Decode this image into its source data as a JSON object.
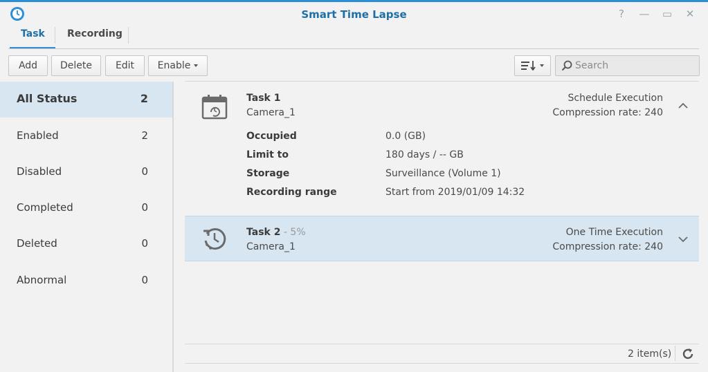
{
  "app": {
    "title": "Smart Time Lapse"
  },
  "window_controls": {
    "help": "?",
    "minimize": "—",
    "maximize": "▭",
    "close": "✕"
  },
  "tabs": [
    {
      "label": "Task"
    },
    {
      "label": "Recording"
    }
  ],
  "toolbar": {
    "add": "Add",
    "delete": "Delete",
    "edit": "Edit",
    "enable": "Enable",
    "search_placeholder": "Search"
  },
  "sidebar": {
    "items": [
      {
        "label": "All Status",
        "count": "2"
      },
      {
        "label": "Enabled",
        "count": "2"
      },
      {
        "label": "Disabled",
        "count": "0"
      },
      {
        "label": "Completed",
        "count": "0"
      },
      {
        "label": "Deleted",
        "count": "0"
      },
      {
        "label": "Abnormal",
        "count": "0"
      }
    ]
  },
  "tasks": [
    {
      "name": "Task 1",
      "camera": "Camera_1",
      "execution": "Schedule Execution",
      "compression": "Compression rate: 240",
      "details": [
        {
          "label": "Occupied",
          "value": "0.0 (GB)"
        },
        {
          "label": "Limit to",
          "value": "180 days / -- GB"
        },
        {
          "label": "Storage",
          "value": "Surveillance (Volume 1)"
        },
        {
          "label": "Recording range",
          "value": "Start from 2019/01/09 14:32"
        }
      ]
    },
    {
      "name": "Task 2",
      "progress": " - 5%",
      "camera": "Camera_1",
      "execution": "One Time Execution",
      "compression": "Compression rate: 240"
    }
  ],
  "footer": {
    "count": "2 item(s)"
  },
  "colors": {
    "accent": "#2d8fd5",
    "title": "#1e6fa6",
    "selected_bg": "#d7e6f1"
  }
}
